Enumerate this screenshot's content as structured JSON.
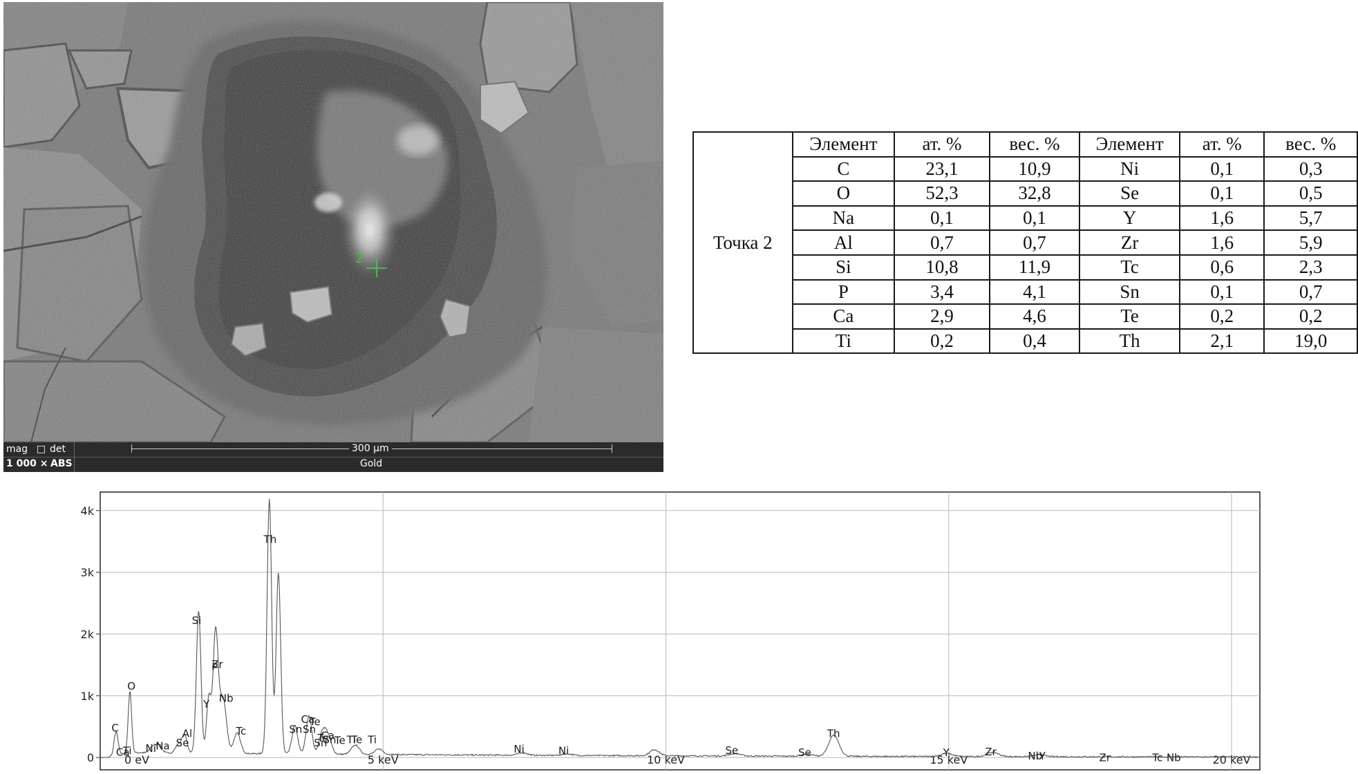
{
  "sem_image": {
    "info_bar": {
      "mag_label": "mag",
      "det_label": "det",
      "mag_value": "1 000 ×",
      "det_value": "ABS",
      "scale_label": "300 µm",
      "coating": "Gold"
    },
    "point_marker_label": "2",
    "marker_color": "#44c044"
  },
  "composition_table": {
    "point_label": "Точка 2",
    "headers": [
      "Элемент",
      "ат. %",
      "вес. %",
      "Элемент",
      "ат. %",
      "вес. %"
    ],
    "rows": [
      [
        "C",
        "23,1",
        "10,9",
        "Ni",
        "0,1",
        "0,3"
      ],
      [
        "O",
        "52,3",
        "32,8",
        "Se",
        "0,1",
        "0,5"
      ],
      [
        "Na",
        "0,1",
        "0,1",
        "Y",
        "1,6",
        "5,7"
      ],
      [
        "Al",
        "0,7",
        "0,7",
        "Zr",
        "1,6",
        "5,9"
      ],
      [
        "Si",
        "10,8",
        "11,9",
        "Tc",
        "0,6",
        "2,3"
      ],
      [
        "P",
        "3,4",
        "4,1",
        "Sn",
        "0,1",
        "0,7"
      ],
      [
        "Ca",
        "2,9",
        "4,6",
        "Te",
        "0,2",
        "0,2"
      ],
      [
        "Ti",
        "0,2",
        "0,4",
        "Th",
        "2,1",
        "19,0"
      ]
    ]
  },
  "chart_data": {
    "type": "line",
    "title": "",
    "xlabel": "",
    "ylabel": "",
    "xlim": [
      0,
      20.5
    ],
    "ylim": [
      -200,
      4300
    ],
    "x_ticks": [
      0,
      5,
      10,
      15,
      20
    ],
    "x_tick_labels": [
      "0 eV",
      "5 keV",
      "10 keV",
      "15 keV",
      "20 keV"
    ],
    "y_ticks": [
      0,
      1000,
      2000,
      3000,
      4000
    ],
    "y_tick_labels": [
      "0",
      "1k",
      "2k",
      "3k",
      "4k"
    ],
    "grid": true,
    "line_color": "#555555",
    "background": 80,
    "peaks": [
      {
        "x": 0.28,
        "y": 380,
        "w": 0.035
      },
      {
        "x": 0.525,
        "y": 1000,
        "w": 0.03
      },
      {
        "x": 0.93,
        "y": 110,
        "w": 0.05
      },
      {
        "x": 1.04,
        "y": 130,
        "w": 0.05
      },
      {
        "x": 1.38,
        "y": 140,
        "w": 0.05
      },
      {
        "x": 1.49,
        "y": 290,
        "w": 0.045
      },
      {
        "x": 1.74,
        "y": 2300,
        "w": 0.04
      },
      {
        "x": 1.92,
        "y": 900,
        "w": 0.04
      },
      {
        "x": 2.04,
        "y": 1950,
        "w": 0.045
      },
      {
        "x": 2.17,
        "y": 900,
        "w": 0.06
      },
      {
        "x": 2.42,
        "y": 330,
        "w": 0.06
      },
      {
        "x": 2.99,
        "y": 4130,
        "w": 0.04
      },
      {
        "x": 3.15,
        "y": 2930,
        "w": 0.04
      },
      {
        "x": 3.44,
        "y": 460,
        "w": 0.05
      },
      {
        "x": 3.69,
        "y": 620,
        "w": 0.05
      },
      {
        "x": 3.93,
        "y": 340,
        "w": 0.06
      },
      {
        "x": 4.03,
        "y": 260,
        "w": 0.06
      },
      {
        "x": 4.51,
        "y": 150,
        "w": 0.07
      },
      {
        "x": 4.93,
        "y": 90,
        "w": 0.07
      },
      {
        "x": 7.47,
        "y": 40,
        "w": 0.08
      },
      {
        "x": 8.26,
        "y": 25,
        "w": 0.08
      },
      {
        "x": 9.8,
        "y": 100,
        "w": 0.08
      },
      {
        "x": 11.22,
        "y": 40,
        "w": 0.1
      },
      {
        "x": 12.5,
        "y": 30,
        "w": 0.1
      },
      {
        "x": 12.97,
        "y": 340,
        "w": 0.09
      },
      {
        "x": 14.96,
        "y": 50,
        "w": 0.1
      },
      {
        "x": 15.78,
        "y": 70,
        "w": 0.1
      },
      {
        "x": 16.6,
        "y": 30,
        "w": 0.1
      }
    ],
    "peak_labels": [
      {
        "text": "C",
        "x": 0.2,
        "y": 420
      },
      {
        "text": "Ca",
        "x": 0.28,
        "y": 30
      },
      {
        "text": "Ti",
        "x": 0.4,
        "y": 50
      },
      {
        "text": "O",
        "x": 0.48,
        "y": 1100
      },
      {
        "text": "Ni",
        "x": 0.8,
        "y": 90
      },
      {
        "text": "Na",
        "x": 0.98,
        "y": 130
      },
      {
        "text": "Se",
        "x": 1.34,
        "y": 180
      },
      {
        "text": "Al",
        "x": 1.45,
        "y": 330
      },
      {
        "text": "Si",
        "x": 1.62,
        "y": 2160
      },
      {
        "text": "Y",
        "x": 1.82,
        "y": 810
      },
      {
        "text": "Zr",
        "x": 1.97,
        "y": 1450
      },
      {
        "text": "P",
        "x": 1.97,
        "y": 1410
      },
      {
        "text": "Nb",
        "x": 2.1,
        "y": 900
      },
      {
        "text": "Tc",
        "x": 2.4,
        "y": 370
      },
      {
        "text": "Th",
        "x": 2.89,
        "y": 3480
      },
      {
        "text": "Sn",
        "x": 3.34,
        "y": 400
      },
      {
        "text": "Ca",
        "x": 3.55,
        "y": 560
      },
      {
        "text": "Sn",
        "x": 3.58,
        "y": 400
      },
      {
        "text": "Te",
        "x": 3.7,
        "y": 520
      },
      {
        "text": "Sn",
        "x": 3.78,
        "y": 180
      },
      {
        "text": "Te",
        "x": 3.84,
        "y": 260
      },
      {
        "text": "Sn",
        "x": 3.94,
        "y": 230
      },
      {
        "text": "Ca",
        "x": 3.9,
        "y": 300
      },
      {
        "text": "Te",
        "x": 4.14,
        "y": 220
      },
      {
        "text": "Ti",
        "x": 4.36,
        "y": 230
      },
      {
        "text": "Te",
        "x": 4.44,
        "y": 230
      },
      {
        "text": "Ti",
        "x": 4.73,
        "y": 230
      },
      {
        "text": "Ni",
        "x": 7.31,
        "y": 80
      },
      {
        "text": "Ni",
        "x": 8.1,
        "y": 50
      },
      {
        "text": "Se",
        "x": 11.05,
        "y": 60
      },
      {
        "text": "Se",
        "x": 12.34,
        "y": 25
      },
      {
        "text": "Th",
        "x": 12.85,
        "y": 330
      },
      {
        "text": "Y",
        "x": 14.9,
        "y": 25
      },
      {
        "text": "Zr",
        "x": 15.64,
        "y": 35
      },
      {
        "text": "Nb",
        "x": 16.4,
        "y": -30
      },
      {
        "text": "Y",
        "x": 16.6,
        "y": -30
      },
      {
        "text": "Zr",
        "x": 17.66,
        "y": -60
      },
      {
        "text": "Tc",
        "x": 18.6,
        "y": -60
      },
      {
        "text": "Nb",
        "x": 18.85,
        "y": -60
      }
    ]
  }
}
